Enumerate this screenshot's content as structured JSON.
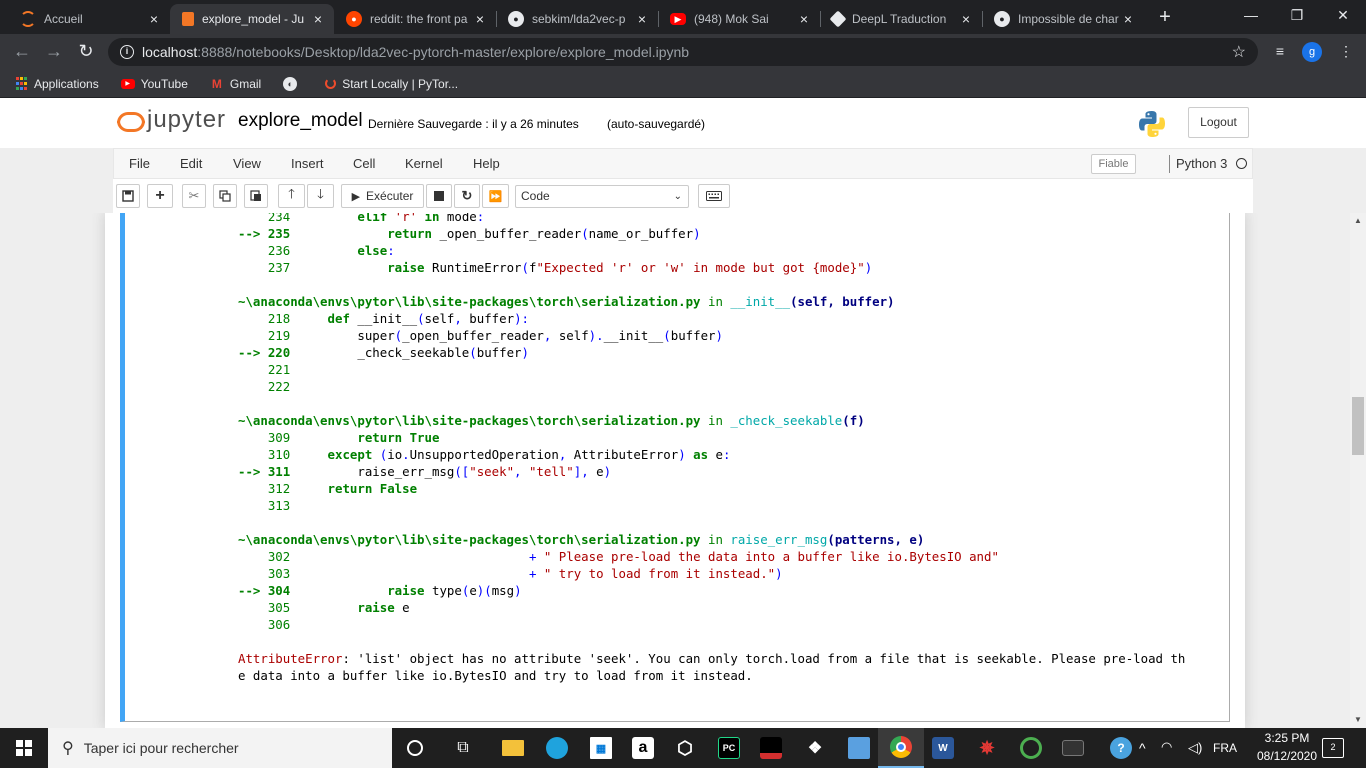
{
  "browser": {
    "tabs": [
      {
        "title": "Accueil",
        "icon": "jupyter-icon",
        "color": "#f37726"
      },
      {
        "title": "explore_model - Ju",
        "icon": "notebook-icon",
        "color": "#f37726"
      },
      {
        "title": "reddit: the front pa",
        "icon": "reddit-icon",
        "color": "#ff4500"
      },
      {
        "title": "sebkim/lda2vec-p",
        "icon": "github-icon",
        "color": "#ffffff"
      },
      {
        "title": "(948) Mok Sai",
        "icon": "youtube-icon",
        "color": "#ff0000"
      },
      {
        "title": "DeepL Traduction",
        "icon": "deepl-icon",
        "color": "#0f2b46"
      },
      {
        "title": "Impossible de char",
        "icon": "github-icon",
        "color": "#ffffff"
      }
    ],
    "new_tab": "+",
    "url_host": "localhost",
    "url_path": ":8888/notebooks/Desktop/lda2vec-pytorch-master/explore/explore_model.ipynb",
    "profile_initial": "g",
    "bookmarks": [
      {
        "label": "Applications",
        "icon": "apps-grid-icon"
      },
      {
        "label": "YouTube",
        "icon": "youtube-icon"
      },
      {
        "label": "Gmail",
        "icon": "gmail-icon"
      },
      {
        "label": "",
        "icon": "globe-icon"
      },
      {
        "label": "Start Locally | PyTor...",
        "icon": "pytorch-icon"
      }
    ]
  },
  "jupyter": {
    "logo_text": "jupyter",
    "notebook_name": "explore_model",
    "save_status": "Dernière Sauvegarde : il y a 26 minutes",
    "autosave_status": "(auto-sauvegardé)",
    "logout_label": "Logout",
    "menu": [
      "File",
      "Edit",
      "View",
      "Insert",
      "Cell",
      "Kernel",
      "Help"
    ],
    "trusted_label": "Fiable",
    "kernel_name": "Python 3",
    "toolbar": {
      "run_label": "Exécuter",
      "cell_type": "Code"
    }
  },
  "traceback": {
    "frame0": {
      "lines": [
        {
          "prefix": "    234 ",
          "code": "        elif 'r' in mode:"
        },
        {
          "prefix": "--> 235 ",
          "code": "            return _open_buffer_reader(name_or_buffer)"
        },
        {
          "prefix": "    236 ",
          "code": "        else:"
        },
        {
          "prefix": "    237 ",
          "code": "            raise RuntimeError(f\"Expected 'r' or 'w' in mode but got {mode}\")"
        }
      ]
    },
    "frame1": {
      "path": "~\\anaconda\\envs\\pytor\\lib\\site-packages\\torch\\serialization.py",
      "func": "__init__",
      "args": "(self, buffer)",
      "lines": [
        {
          "prefix": "    218 ",
          "code": "    def __init__(self, buffer):"
        },
        {
          "prefix": "    219 ",
          "code": "        super(_open_buffer_reader, self).__init__(buffer)"
        },
        {
          "prefix": "--> 220 ",
          "code": "        _check_seekable(buffer)"
        },
        {
          "prefix": "    221 ",
          "code": ""
        },
        {
          "prefix": "    222 ",
          "code": ""
        }
      ]
    },
    "frame2": {
      "path": "~\\anaconda\\envs\\pytor\\lib\\site-packages\\torch\\serialization.py",
      "func": "_check_seekable",
      "args": "(f)",
      "lines": [
        {
          "prefix": "    309 ",
          "code": "        return True"
        },
        {
          "prefix": "    310 ",
          "code": "    except (io.UnsupportedOperation, AttributeError) as e:"
        },
        {
          "prefix": "--> 311 ",
          "code": "        raise_err_msg([\"seek\", \"tell\"], e)"
        },
        {
          "prefix": "    312 ",
          "code": "    return False"
        },
        {
          "prefix": "    313 ",
          "code": ""
        }
      ]
    },
    "frame3": {
      "path": "~\\anaconda\\envs\\pytor\\lib\\site-packages\\torch\\serialization.py",
      "func": "raise_err_msg",
      "args": "(patterns, e)",
      "lines": [
        {
          "prefix": "    302 ",
          "code": "                               + \" Please pre-load the data into a buffer like io.BytesIO and\""
        },
        {
          "prefix": "    303 ",
          "code": "                               + \" try to load from it instead.\")"
        },
        {
          "prefix": "--> 304 ",
          "code": "            raise type(e)(msg)"
        },
        {
          "prefix": "    305 ",
          "code": "        raise e"
        },
        {
          "prefix": "    306 ",
          "code": ""
        }
      ]
    },
    "in_word": "in",
    "error_name": "AttributeError",
    "error_msg_1": ": 'list' object has no attribute 'seek'. You can only torch.load from a file that is seekable. Please pre-load th",
    "error_msg_2": "e data into a buffer like io.BytesIO and try to load from it instead."
  },
  "taskbar": {
    "search_placeholder": "Taper ici pour rechercher",
    "language": "FRA",
    "time": "3:25 PM",
    "date": "08/12/2020",
    "notification_count": "2"
  },
  "colors": {
    "selected_cell_border": "#42a5f5",
    "jupyter_orange": "#f37726",
    "chrome_dark": "#202124"
  }
}
